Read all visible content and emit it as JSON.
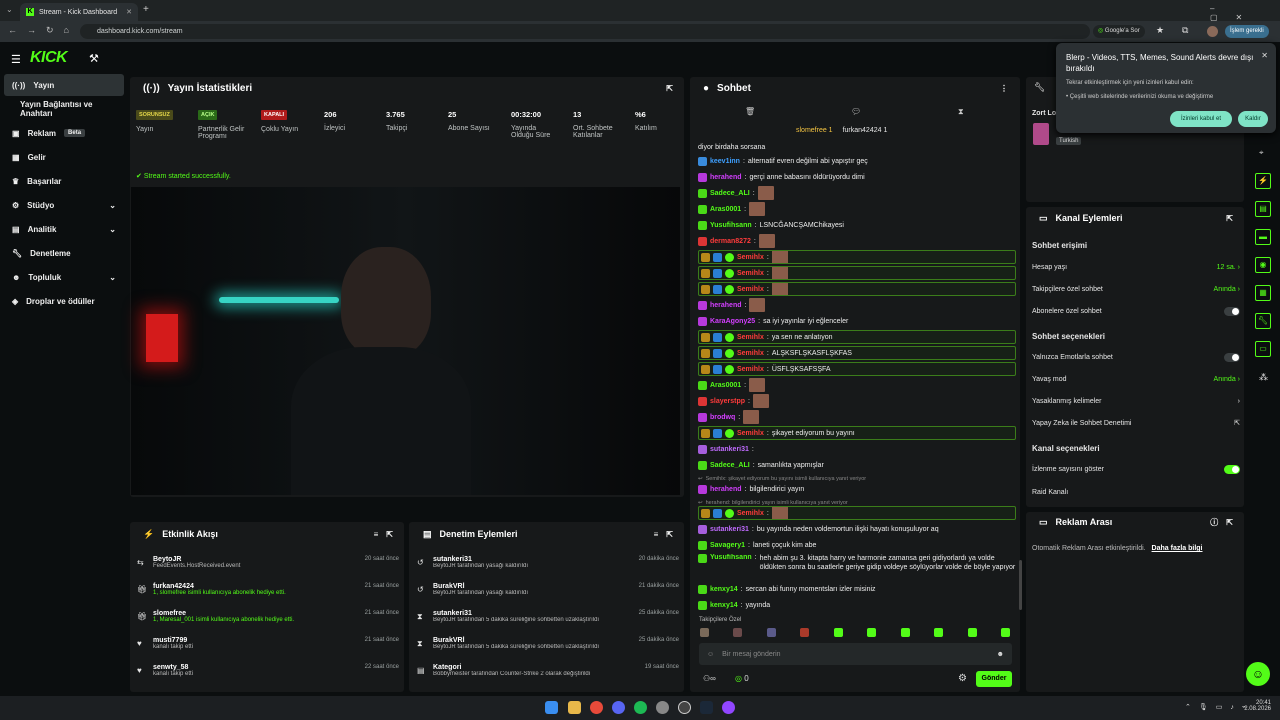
{
  "browser": {
    "tab_title": "Stream - Kick Dashboard",
    "url": "dashboard.kick.com/stream",
    "google_ask": "Google'a Sor",
    "profile_action": "İşlem gerekli"
  },
  "brand": {
    "logo": "KICK",
    "accent": "#53fc18"
  },
  "sidebar": {
    "items": [
      {
        "label": "Yayın",
        "icon": "stream-icon"
      },
      {
        "label": "Yayın Bağlantısı ve Anahtarı",
        "icon": ""
      },
      {
        "label": "Reklam",
        "icon": "ad-icon",
        "badge": "Beta"
      },
      {
        "label": "Gelir",
        "icon": "revenue-icon"
      },
      {
        "label": "Başarılar",
        "icon": "trophy-icon"
      },
      {
        "label": "Stüdyo",
        "icon": "studio-icon"
      },
      {
        "label": "Analitik",
        "icon": "analytics-icon"
      },
      {
        "label": "Denetleme",
        "icon": "wrench-icon"
      },
      {
        "label": "Topluluk",
        "icon": "community-icon"
      },
      {
        "label": "Droplar ve ödüller",
        "icon": "drops-icon"
      }
    ]
  },
  "stats": {
    "title": "Yayın İstatistikleri",
    "success": "Stream started successfully.",
    "items": [
      {
        "value": "SORUNSUZ",
        "label": "Yayın"
      },
      {
        "value": "AÇIK",
        "label": "Partnerlik Gelir Programı"
      },
      {
        "value": "KAPALI",
        "label": "Çoklu Yayın"
      },
      {
        "value": "206",
        "label": "İzleyici"
      },
      {
        "value": "3.765",
        "label": "Takipçi"
      },
      {
        "value": "25",
        "label": "Abone Sayısı"
      },
      {
        "value": "00:32:00",
        "label": "Yayında Olduğu Süre"
      },
      {
        "value": "13",
        "label": "Ort. Sohbete Katılanlar"
      },
      {
        "value": "%6",
        "label": "Katılım"
      }
    ]
  },
  "activity": {
    "title": "Etkinlik Akışı",
    "rows": [
      {
        "name": "BeytoJR",
        "sub": "FeedEvents.HostReceived.event",
        "time": "20 saat önce"
      },
      {
        "name": "furkan42424",
        "sub": "1, slomefree isimli kullanıcıya abonelik hediye etti.",
        "time": "21 saat önce"
      },
      {
        "name": "slomefree",
        "sub": "1, Maresal_001 isimli kullanıcıya abonelik hediye etti.",
        "time": "21 saat önce"
      },
      {
        "name": "musti7799",
        "sub": "kanalı takip etti",
        "time": "21 saat önce"
      },
      {
        "name": "senwty_58",
        "sub": "kanalı takip etti",
        "time": "22 saat önce"
      }
    ]
  },
  "moderation": {
    "title": "Denetim Eylemleri",
    "rows": [
      {
        "name": "sutankeri31",
        "sub": "BeytoJR tarafından yasağı kaldırıldı",
        "time": "20 dakika önce"
      },
      {
        "name": "BurakVRl",
        "sub": "BeytoJR tarafından yasağı kaldırıldı",
        "time": "21 dakika önce"
      },
      {
        "name": "sutankeri31",
        "sub": "BeytoJR tarafından 5 dakika süreliğine sohbetten uzaklaştırıldı",
        "time": "25 dakika önce"
      },
      {
        "name": "BurakVRl",
        "sub": "BeytoJR tarafından 5 dakika süreliğine sohbetten uzaklaştırıldı",
        "time": "25 dakika önce"
      },
      {
        "name": "Kategori",
        "sub": "Bobbymeister tarafından Counter-Strike 2 olarak değiştirildi",
        "time": "19 saat önce"
      }
    ]
  },
  "chat": {
    "title": "Sohbet",
    "pinned": [
      "slomefree 1",
      "furkan42424 1"
    ],
    "messages": [
      {
        "user": "",
        "text": "diyor birdaha sorsana",
        "color": "#e6e6e6",
        "hl": false
      },
      {
        "user": "keev1inn",
        "text": "alternatif evren değilmi abi yapıştır geç",
        "color": "#3fa0ff",
        "hl": false
      },
      {
        "user": "herahend",
        "text": "gerçi anne babasını öldürüyordu dimi",
        "color": "#d33fff",
        "hl": false
      },
      {
        "user": "Sadece_ALI",
        "text": "",
        "color": "#53fc18",
        "hl": false
      },
      {
        "user": "Aras0001",
        "text": "",
        "color": "#53fc18",
        "hl": false
      },
      {
        "user": "Yusufihsann",
        "text": "LSNCĞANCŞAMChikayesi",
        "color": "#53fc18",
        "hl": false
      },
      {
        "user": "derman8272",
        "text": "",
        "color": "#ff3b3b",
        "hl": false
      },
      {
        "user": "Semihlx",
        "text": "",
        "color": "#ff3b3b",
        "hl": true
      },
      {
        "user": "Semihlx",
        "text": "",
        "color": "#ff3b3b",
        "hl": true
      },
      {
        "user": "Semihlx",
        "text": "",
        "color": "#ff3b3b",
        "hl": true
      },
      {
        "user": "herahend",
        "text": "",
        "color": "#d33fff",
        "hl": false
      },
      {
        "user": "KaraAgony25",
        "text": "sa iyi yayınlar iyi eğlenceler",
        "color": "#d33fff",
        "hl": false
      },
      {
        "user": "Semihlx",
        "text": "ya sen ne anlatıyon",
        "color": "#ff3b3b",
        "hl": true
      },
      {
        "user": "Semihlx",
        "text": "ALŞKSFLŞKASFLŞKFAS",
        "color": "#ff3b3b",
        "hl": true
      },
      {
        "user": "Semihlx",
        "text": "ÜSFLŞKSAFSŞFA",
        "color": "#ff3b3b",
        "hl": true
      },
      {
        "user": "Aras0001",
        "text": "",
        "color": "#53fc18",
        "hl": false
      },
      {
        "user": "slayerstpp",
        "text": "",
        "color": "#ff3b3b",
        "hl": false
      },
      {
        "user": "brodwq",
        "text": "",
        "color": "#d33fff",
        "hl": false
      },
      {
        "user": "Semihlx",
        "text": "şikayet ediyorum bu yayını",
        "color": "#ff3b3b",
        "hl": true
      },
      {
        "user": "sutankeri31",
        "text": "",
        "color": "#c06bff",
        "hl": false
      },
      {
        "user": "Sadece_ALI",
        "text": "samanlıkta yapmışlar",
        "color": "#53fc18",
        "hl": false
      },
      {
        "user": "herahend",
        "text": "bilgilendirici yayın",
        "color": "#d33fff",
        "hl": false
      },
      {
        "user": "Semihlx",
        "text": "",
        "color": "#ff3b3b",
        "hl": true
      },
      {
        "user": "sutankeri31",
        "text": "bu yayında neden voldemortun ilişki hayatı konuşuluyor aq",
        "color": "#c06bff",
        "hl": false
      },
      {
        "user": "Savagery1",
        "text": "laneti çoçuk kim abe",
        "color": "#53fc18",
        "hl": false
      },
      {
        "user": "Yusufihsann",
        "text": "heh abim şu 3. kitapta harry ve harmonie zamansa geri gidiyorlardı ya volde öldükten sonra bu saatlerle geriye gidip voldeye söylüyorlar volde de böyle yapıyor",
        "color": "#53fc18",
        "hl": false
      },
      {
        "user": "kenxy14",
        "text": "sercan abi funny momentsları izler misiniz",
        "color": "#53fc18",
        "hl": false
      },
      {
        "user": "kenxy14",
        "text": "yayında",
        "color": "#53fc18",
        "hl": false
      }
    ],
    "reply_note_1": "Semihlx: şikayet ediyorum bu yayını isimli kullanıcıya yanıt veriyor",
    "reply_note_2": "herahend: bilgilendirici yayın isimli kullanıcıya yanıt veriyor",
    "followers_label": "Takipçilere Özel",
    "input_placeholder": "Bir mesaj gönderin",
    "send_label": "Gönder",
    "points": "0"
  },
  "popup": {
    "title": "Blerp - Videos, TTS, Memes, Sound Alerts devre dışı bırakıldı",
    "body": "Tekrar etkinleştirmek için yeni izinleri kabul edin:",
    "bullet": "Çeşitli web sitelerinde verilerinizi okuma ve değiştirme",
    "accept": "İzinleri kabul et",
    "remove": "Kaldır"
  },
  "side_panel": {
    "user_prefix": "Zort Lo",
    "tag": "Turkish"
  },
  "channel_actions": {
    "title": "Kanal Eylemleri",
    "chat_access": "Sohbet erişimi",
    "rows1": [
      {
        "label": "Hesap yaşı",
        "value": "12 sa."
      },
      {
        "label": "Takipçilere özel sohbet",
        "value": "Anında"
      },
      {
        "label": "Abonelere özel sohbet",
        "value": ""
      }
    ],
    "chat_options": "Sohbet seçenekleri",
    "rows2": [
      {
        "label": "Yalnızca Emotlarla sohbet",
        "value": ""
      },
      {
        "label": "Yavaş mod",
        "value": "Anında"
      },
      {
        "label": "Yasaklanmış kelimeler",
        "value": ""
      },
      {
        "label": "Yapay Zeka ile Sohbet Denetimi",
        "value": ""
      }
    ],
    "channel_options": "Kanal seçenekleri",
    "rows3": [
      {
        "label": "İzlenme sayısını göster",
        "value": ""
      },
      {
        "label": "Raid Kanalı",
        "value": ""
      }
    ]
  },
  "ad_break": {
    "title": "Reklam Arası",
    "text": "Otomatik Reklam Arası etkinleştirildi.",
    "link": "Daha fazla bilgi"
  },
  "taskbar": {
    "time": "20:41",
    "date": "2.08.2026"
  }
}
